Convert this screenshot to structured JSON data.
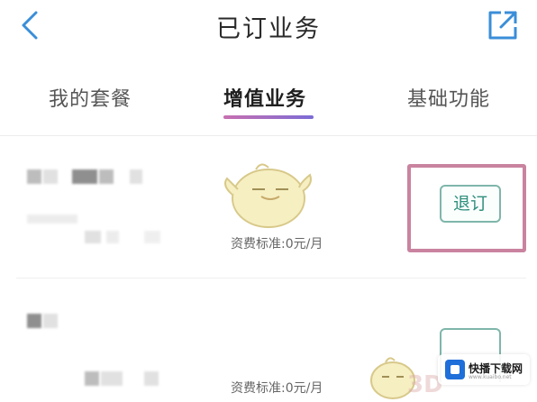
{
  "header": {
    "title": "已订业务",
    "back_icon": "chevron-left-icon",
    "share_icon": "external-link-icon"
  },
  "tabs": [
    {
      "label": "我的套餐",
      "active": false
    },
    {
      "label": "增值业务",
      "active": true
    },
    {
      "label": "基础功能",
      "active": false
    }
  ],
  "services": [
    {
      "fee": "资费标准:0元/月",
      "action_label": "退订"
    },
    {
      "fee": "资费标准:0元/月",
      "action_label": ""
    }
  ],
  "watermark": {
    "name": "快播下载网",
    "sub": "www.kuaibo.net",
    "mark": "3D"
  },
  "colors": {
    "accent_gradient_start": "#c86fb0",
    "accent_gradient_end": "#7b6cd6",
    "button_border": "#7fb6aa",
    "button_text": "#2f8e7d",
    "highlight": "#c9839f"
  }
}
